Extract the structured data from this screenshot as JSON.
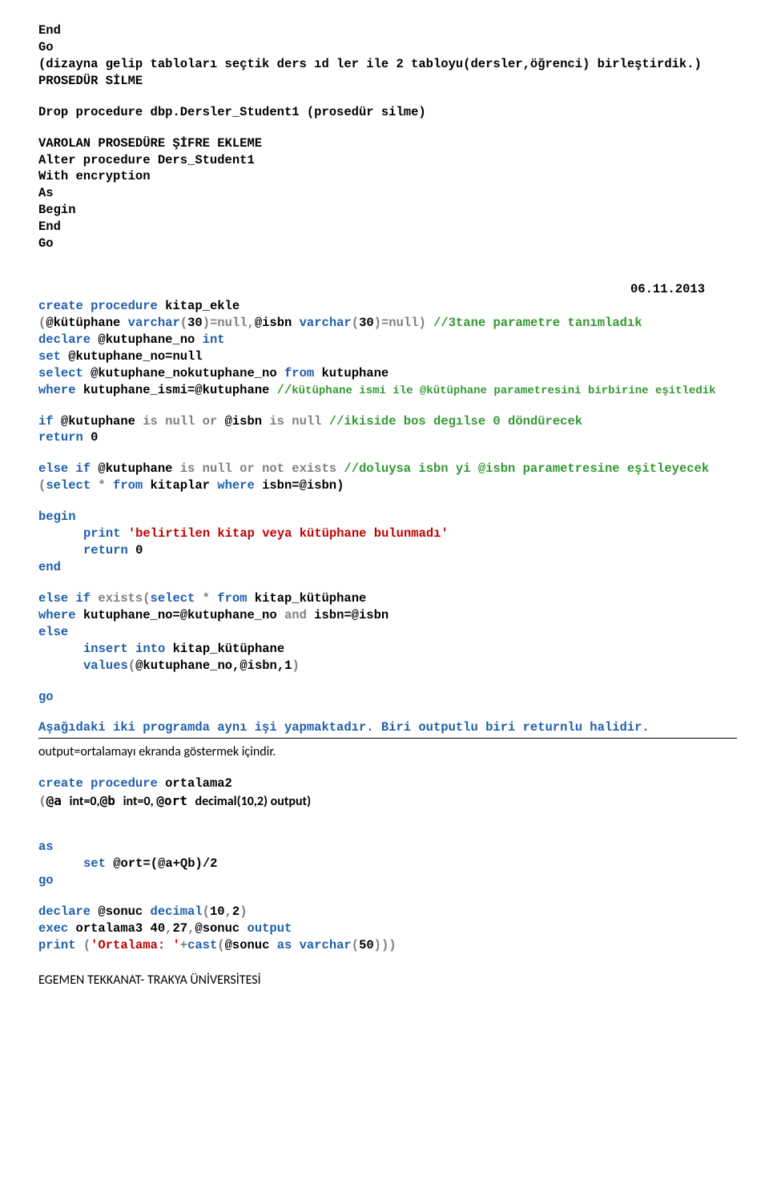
{
  "l1": "End",
  "l2": "Go",
  "l3": "(dizayna gelip tabloları seçtik ders ıd ler ile 2 tabloyu(dersler,öğrenci) birleştirdik.)",
  "l4": "PROSEDÜR SİLME",
  "l5": "Drop procedure dbp.Dersler_Student1 (prosedür silme)",
  "l6": "VAROLAN PROSEDÜRE ŞİFRE EKLEME",
  "l7": "Alter procedure Ders_Student1",
  "l8": "With encryption",
  "l9": "As",
  "l10": "Begin",
  "l11": "End",
  "l12": "Go",
  "date": "06.11.2013",
  "cp1a": "create procedure",
  "cp1b": " kitap_ekle",
  "cp2a": "(",
  "cp2b": "@kütüphane ",
  "cp2c": "varchar",
  "cp2d": "(",
  "cp2e": "30",
  "cp2f": ")=null,",
  "cp2g": "@isbn ",
  "cp2h": "varchar",
  "cp2i": "(",
  "cp2j": "30",
  "cp2k": ")=null) ",
  "cp2l": "//3tane parametre tanımladık",
  "cp3a": "declare ",
  "cp3b": "@kutuphane_no ",
  "cp3c": "int",
  "cp4a": "set ",
  "cp4b": "@kutuphane_no=null",
  "cp5a": "select ",
  "cp5b": "@kutuphane_nokutuphane_no ",
  "cp5c": "from",
  "cp5d": " kutuphane",
  "cp6a": "where",
  "cp6b": " kutuphane_ismi=@kutuphane ",
  "cp6c": "//",
  "cp6d": "kütüphane ismi ile @kütüphane parametresini birbirine eşitledik",
  "if1a": "if ",
  "if1b": "@kutuphane ",
  "if1c": "is null or ",
  "if1d": "@isbn ",
  "if1e": "is null ",
  "if1f": "//ikiside bos degılse 0 döndürecek",
  "ret0a": "return ",
  "ret0b": "0",
  "elif1a": "else if ",
  "elif1b": "@kutuphane ",
  "elif1c": "is null or not exists ",
  "elif1d": "//doluysa isbn yi @isbn parametresine eşitleyecek",
  "sel1a": "(",
  "sel1b": "select",
  "sel1c": " * ",
  "sel1d": "from",
  "sel1e": " kitaplar ",
  "sel1f": "where",
  "sel1g": " isbn=@isbn)",
  "begin": "begin",
  "print1a": "print ",
  "print1b": "'belirtilen kitap veya kütüphane bulunmadı'",
  "ret1a": "return ",
  "ret1b": "0",
  "end": "end",
  "elif2a": "else if ",
  "elif2b": "exists",
  "elif2c": "(",
  "elif2d": "select",
  "elif2e": " * ",
  "elif2f": "from",
  "elif2g": " kitap_kütüphane",
  "wh2a": "where",
  "wh2b": " kutuphane_no=@kutuphane_no ",
  "wh2c": "and",
  "wh2d": " isbn=@isbn",
  "else2": "else",
  "ins1a": "insert into",
  "ins1b": " kitap_kütüphane",
  "val1a": "values",
  "val1b": "(",
  "val1c": "@kutuphane_no,@isbn,",
  "val1d": "1",
  "val1e": ")",
  "go1": "go",
  "note1": "Aşağıdaki iki programda aynı işi yapmaktadır. Biri outputlu biri returnlu halidir.",
  "note2": "output=ortalamayı ekranda göstermek içindir.",
  "ort1a": "create procedure",
  "ort1b": " ortalama2",
  "ort2a": "(",
  "ort2b": "@a ",
  "ort2c": "int=0,",
  "ort2d": "@b ",
  "ort2e": "int=0, ",
  "ort2f": "@ort ",
  "ort2g": "decimal(10,2) output)",
  "as": "as",
  "set1a": "set ",
  "set1b": "@ort=(@a+Qb)/",
  "set1c": "2",
  "go2": "go",
  "dec1a": "declare ",
  "dec1b": "@sonuc ",
  "dec1c": "decimal",
  "dec1d": "(",
  "dec1e": "10",
  "dec1f": ",",
  "dec1g": "2",
  "dec1h": ")",
  "exec1a": "exec",
  "exec1b": " ortalama3 ",
  "exec1c": "40",
  "exec1d": ",",
  "exec1e": "27",
  "exec1f": ",",
  "exec1g": "@sonuc ",
  "exec1h": "output",
  "pr1a": "print ",
  "pr1b": "(",
  "pr1c": "'Ortalama: '",
  "pr1d": "+",
  "pr1e": "cast",
  "pr1f": "(",
  "pr1g": "@sonuc ",
  "pr1h": "as ",
  "pr1i": "varchar",
  "pr1j": "(",
  "pr1k": "50",
  "pr1l": ")))",
  "footer": "EGEMEN TEKKANAT- TRAKYA ÜNİVERSİTESİ"
}
